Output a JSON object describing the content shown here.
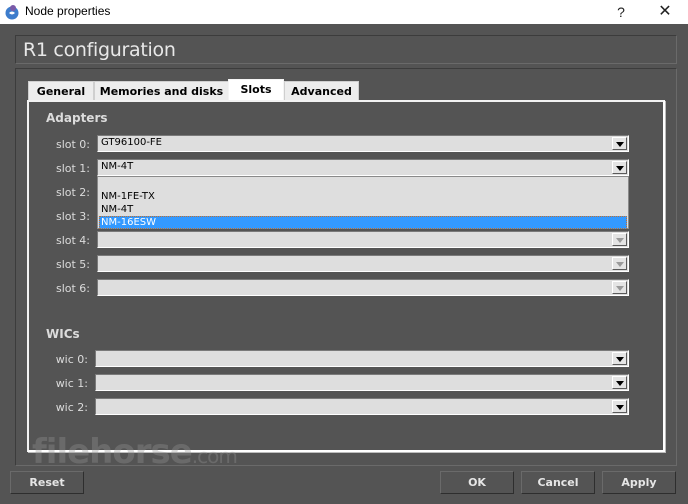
{
  "window": {
    "title": "Node properties",
    "help_label": "?",
    "close_label": "✕"
  },
  "header": {
    "title": "R1 configuration"
  },
  "tabs": [
    {
      "label": "General",
      "active": false
    },
    {
      "label": "Memories and disks",
      "active": false
    },
    {
      "label": "Slots",
      "active": true
    },
    {
      "label": "Advanced",
      "active": false
    }
  ],
  "adapters": {
    "title": "Adapters",
    "slots": [
      {
        "label": "slot 0:",
        "value": "GT96100-FE",
        "enabled": true
      },
      {
        "label": "slot 1:",
        "value": "NM-4T",
        "enabled": true,
        "open": true
      },
      {
        "label": "slot 2:",
        "value": "",
        "enabled": true
      },
      {
        "label": "slot 3:",
        "value": "",
        "enabled": true
      },
      {
        "label": "slot 4:",
        "value": "",
        "enabled": false
      },
      {
        "label": "slot 5:",
        "value": "",
        "enabled": false
      },
      {
        "label": "slot 6:",
        "value": "",
        "enabled": false
      }
    ],
    "dropdown_options": [
      {
        "label": "",
        "selected": false
      },
      {
        "label": "NM-1FE-TX",
        "selected": false
      },
      {
        "label": "NM-4T",
        "selected": false
      },
      {
        "label": "NM-16ESW",
        "selected": true
      }
    ]
  },
  "wics": {
    "title": "WICs",
    "slots": [
      {
        "label": "wic 0:",
        "value": ""
      },
      {
        "label": "wic 1:",
        "value": ""
      },
      {
        "label": "wic 2:",
        "value": ""
      }
    ]
  },
  "buttons": {
    "reset": "Reset",
    "ok": "OK",
    "cancel": "Cancel",
    "apply": "Apply"
  },
  "watermark": {
    "text": "filehorse",
    "suffix": ".com"
  },
  "colors": {
    "background": "#545454",
    "selection": "#3399ff",
    "field": "#dedede"
  }
}
